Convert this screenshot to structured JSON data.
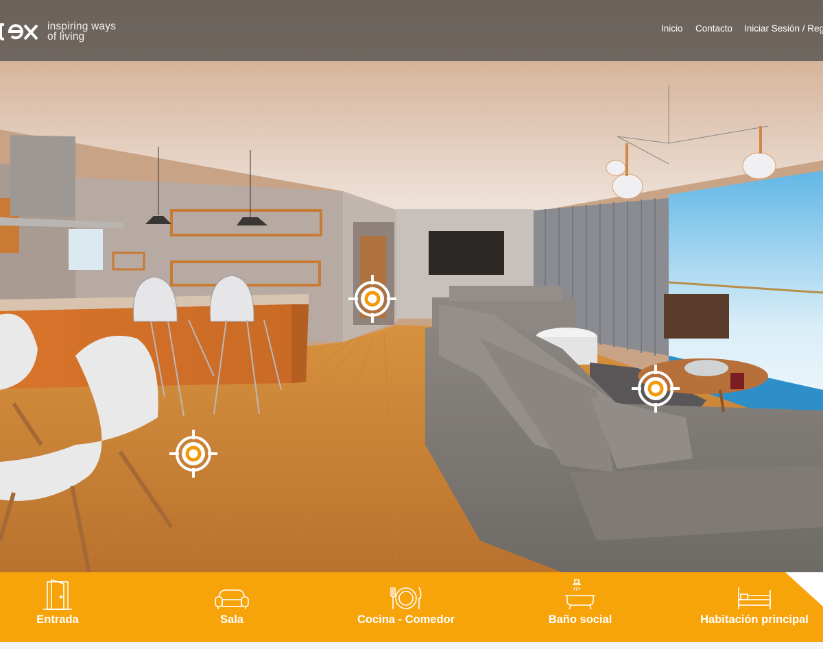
{
  "header": {
    "tagline_line1": "inspiring ways",
    "tagline_line2": "of living",
    "logo_partial": "ex",
    "nav": [
      {
        "label": "Inicio"
      },
      {
        "label": "Contacto"
      },
      {
        "label": "Iniciar Sesión / Regis"
      }
    ]
  },
  "hotspots": [
    {
      "name": "hotspot-hallway",
      "icon": "target-icon"
    },
    {
      "name": "hotspot-living",
      "icon": "target-icon"
    },
    {
      "name": "hotspot-kitchen",
      "icon": "target-icon"
    }
  ],
  "rooms": [
    {
      "label": "Entrada",
      "icon": "door-icon"
    },
    {
      "label": "Sala",
      "icon": "sofa-icon"
    },
    {
      "label": "Cocina - Comedor",
      "icon": "dining-plate-icon"
    },
    {
      "label": "Baño social",
      "icon": "bathtub-icon"
    },
    {
      "label": "Habitación principal",
      "icon": "bed-icon"
    }
  ],
  "colors": {
    "accent": "#f7a30a",
    "header_bg": "#6c635d",
    "hotspot_ring": "#f29a0c"
  }
}
